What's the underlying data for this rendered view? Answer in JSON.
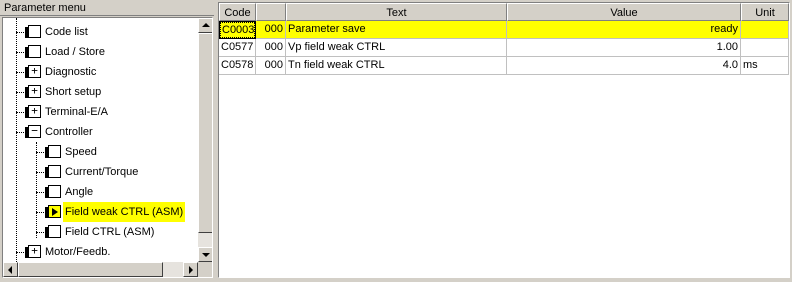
{
  "left_panel": {
    "title": "Parameter menu",
    "tree": [
      {
        "label": "Code list",
        "icon": "folder-plain-icon"
      },
      {
        "label": "Load / Store",
        "icon": "folder-plain-icon"
      },
      {
        "label": "Diagnostic",
        "icon": "folder-expand-icon"
      },
      {
        "label": "Short setup",
        "icon": "folder-expand-icon"
      },
      {
        "label": "Terminal-E/A",
        "icon": "folder-expand-icon"
      },
      {
        "label": "Controller",
        "icon": "folder-collapse-icon"
      },
      {
        "label": "Speed",
        "icon": "folder-plain-icon"
      },
      {
        "label": "Current/Torque",
        "icon": "folder-plain-icon"
      },
      {
        "label": "Angle",
        "icon": "folder-plain-icon"
      },
      {
        "label": "Field weak CTRL (ASM)",
        "icon": "folder-active-icon",
        "selected": true
      },
      {
        "label": "Field CTRL (ASM)",
        "icon": "folder-plain-icon"
      },
      {
        "label": "Motor/Feedb.",
        "icon": "folder-expand-icon"
      }
    ]
  },
  "table": {
    "columns": [
      "Code",
      "",
      "Text",
      "Value",
      "Unit"
    ],
    "rows": [
      {
        "code": "C0003",
        "sub": "000",
        "text": "Parameter save",
        "value": "ready",
        "unit": "",
        "highlight": true
      },
      {
        "code": "C0577",
        "sub": "000",
        "text": "Vp field weak CTRL",
        "value": "1.00",
        "unit": ""
      },
      {
        "code": "C0578",
        "sub": "000",
        "text": "Tn field weak CTRL",
        "value": "4.0",
        "unit": "ms"
      }
    ]
  },
  "colors": {
    "highlight": "#ffff00",
    "window_bg": "#d4d0c8"
  }
}
